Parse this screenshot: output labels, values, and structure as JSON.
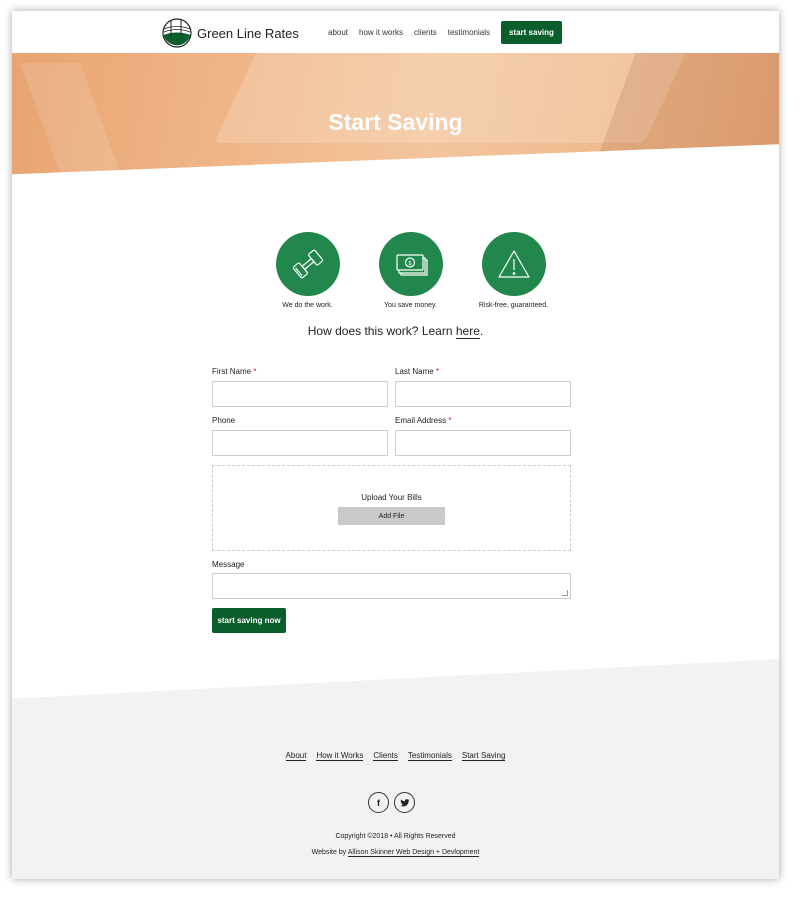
{
  "header": {
    "brand": "Green Line Rates",
    "nav": [
      "about",
      "how it works",
      "clients",
      "testimonials"
    ],
    "cta": "start saving"
  },
  "hero": {
    "title": "Start Saving"
  },
  "features": [
    {
      "icon": "dumbbell-icon",
      "label": "We do the work."
    },
    {
      "icon": "money-icon",
      "label": "You save money."
    },
    {
      "icon": "warning-icon",
      "label": "Risk-free, guaranteed."
    }
  ],
  "learn": {
    "text": "How does this work? Learn ",
    "link": "here",
    "end": "."
  },
  "form": {
    "first_name": "First Name",
    "last_name": "Last Name",
    "phone": "Phone",
    "email": "Email Address",
    "required_mark": "*",
    "upload_label": "Upload Your Bills",
    "add_file": "Add File",
    "message": "Message",
    "submit": "start saving now"
  },
  "footer": {
    "links": [
      "About",
      "How it Works",
      "Clients",
      "Testimonials",
      "Start Saving"
    ],
    "social": {
      "facebook": "f",
      "twitter": "twitter"
    },
    "copyright": "Copyright ©2018 • All Rights Reserved",
    "credit_prefix": "Website by ",
    "credit_link": "Allison Skinner Web Design + Devlopment"
  },
  "colors": {
    "brand_green": "#0a5e2c",
    "icon_green": "#21874d",
    "hero": "#f0b688",
    "required": "#c21919"
  }
}
